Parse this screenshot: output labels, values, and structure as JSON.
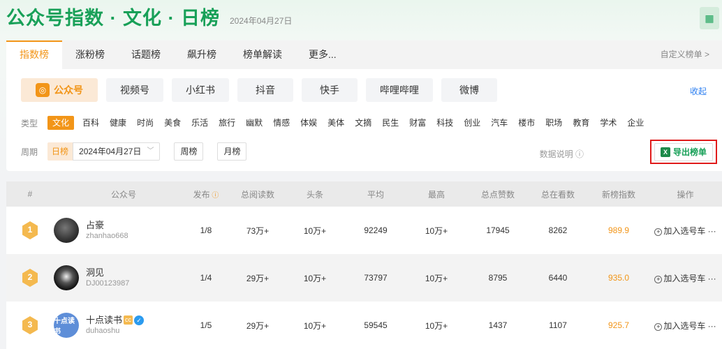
{
  "header": {
    "title": "公众号指数 · 文化 · 日榜",
    "date": "2024年04月27日",
    "qr_icon": "qr-code-icon"
  },
  "tabs": [
    {
      "label": "指数榜",
      "active": true
    },
    {
      "label": "涨粉榜"
    },
    {
      "label": "话题榜"
    },
    {
      "label": "飙升榜"
    },
    {
      "label": "榜单解读"
    },
    {
      "label": "更多..."
    }
  ],
  "custom_list": "自定义榜单 >",
  "platforms": [
    {
      "label": "公众号",
      "active": true,
      "icon": "wechat-official-icon"
    },
    {
      "label": "视频号"
    },
    {
      "label": "小红书"
    },
    {
      "label": "抖音"
    },
    {
      "label": "快手"
    },
    {
      "label": "哔哩哔哩"
    },
    {
      "label": "微博"
    }
  ],
  "collapse_label": "收起",
  "types": {
    "label": "类型",
    "items": [
      "文化",
      "百科",
      "健康",
      "时尚",
      "美食",
      "乐活",
      "旅行",
      "幽默",
      "情感",
      "体娱",
      "美体",
      "文摘",
      "民生",
      "财富",
      "科技",
      "创业",
      "汽车",
      "楼市",
      "职场",
      "教育",
      "学术",
      "企业"
    ],
    "active": "文化"
  },
  "period": {
    "label": "周期",
    "day_label": "日榜",
    "date_value": "2024年04月27日",
    "week_label": "周榜",
    "month_label": "月榜"
  },
  "data_explain": "数据说明 ⓘ",
  "export_label": "导出榜单",
  "table": {
    "headers": {
      "rank": "#",
      "account": "公众号",
      "publish": "发布",
      "total_reads": "总阅读数",
      "headline": "头条",
      "avg": "平均",
      "max": "最高",
      "likes": "总点赞数",
      "viewing": "总在看数",
      "index": "新榜指数",
      "op": "操作"
    },
    "rows": [
      {
        "rank": "1",
        "name": "占豪",
        "id": "zhanhao668",
        "publish": "1/8",
        "total_reads": "73万+",
        "headline": "10万+",
        "avg": "92249",
        "max": "10万+",
        "likes": "17945",
        "viewing": "8262",
        "index": "989.9",
        "op": "加入选号车 ···"
      },
      {
        "rank": "2",
        "name": "洞见",
        "id": "DJ00123987",
        "publish": "1/4",
        "total_reads": "29万+",
        "headline": "10万+",
        "avg": "73797",
        "max": "10万+",
        "likes": "8795",
        "viewing": "6440",
        "index": "935.0",
        "op": "加入选号车 ···"
      },
      {
        "rank": "3",
        "name": "十点读书",
        "id": "duhaoshu",
        "publish": "1/5",
        "total_reads": "29万+",
        "headline": "10万+",
        "avg": "59545",
        "max": "10万+",
        "likes": "1437",
        "viewing": "1107",
        "index": "925.7",
        "op": "加入选号车 ···",
        "badge_cc": "cc",
        "avatar_text": "十点读书"
      }
    ]
  },
  "colors": {
    "brand_green": "#18a058",
    "accent_orange": "#f29518",
    "link_blue": "#2b7ef0",
    "highlight_red": "#e01b1b"
  }
}
